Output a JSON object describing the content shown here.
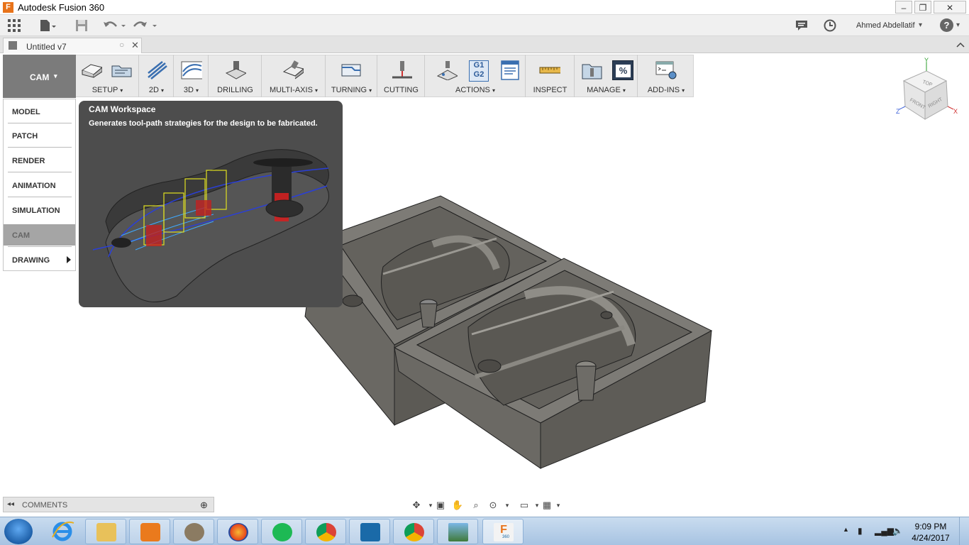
{
  "window": {
    "title": "Autodesk Fusion 360",
    "logo_letter": "F",
    "minimize": "‒",
    "restore": "❐",
    "close": "✕"
  },
  "appbar": {
    "user_name": "Ahmed Abdellatif",
    "help_label": "?",
    "icons": [
      "grid-icon",
      "file-icon",
      "save-icon",
      "undo-icon",
      "redo-icon",
      "comment-icon",
      "clock-icon",
      "help-icon"
    ]
  },
  "tab": {
    "name": "Untitled v7",
    "close": "✕"
  },
  "toolbar": {
    "workspace": "CAM",
    "groups": [
      {
        "label": "SETUP"
      },
      {
        "label": "2D"
      },
      {
        "label": "3D"
      },
      {
        "label": "DRILLING"
      },
      {
        "label": "MULTI-AXIS"
      },
      {
        "label": "TURNING"
      },
      {
        "label": "CUTTING"
      },
      {
        "label": "ACTIONS"
      },
      {
        "label": "INSPECT"
      },
      {
        "label": "MANAGE"
      },
      {
        "label": "ADD-INS"
      }
    ],
    "dropdown_arrow": "▾",
    "actions_codes": [
      "G1",
      "G2"
    ],
    "manage_symbol": "%"
  },
  "workspace_menu": {
    "items": [
      {
        "label": "MODEL"
      },
      {
        "label": "PATCH"
      },
      {
        "label": "RENDER"
      },
      {
        "label": "ANIMATION"
      },
      {
        "label": "SIMULATION"
      },
      {
        "label": "CAM",
        "active": true
      },
      {
        "label": "DRAWING",
        "submenu": true
      }
    ]
  },
  "tooltip": {
    "title": "CAM Workspace",
    "description": "Generates tool-path strategies for the design to be fabricated."
  },
  "viewcube": {
    "faces": {
      "top": "TOP",
      "front": "FRONT",
      "right": "RIGHT"
    },
    "axes": {
      "x": "X",
      "y": "Y",
      "z": "Z"
    }
  },
  "bottom": {
    "comments_label": "COMMENTS",
    "collapse": "◂◂",
    "add": "⊕"
  },
  "taskbar": {
    "time": "9:09 PM",
    "date": "4/24/2017",
    "app_icons": [
      "internet-explorer",
      "file-explorer",
      "media-player",
      "gimp",
      "firefox",
      "spotify",
      "chrome",
      "brackets",
      "chrome",
      "photo-viewer",
      "fusion-360"
    ],
    "fusion_label": "360"
  },
  "colors": {
    "accent": "#e8731a",
    "toolbar": "#e9e9e9",
    "workspace_button": "#7b7b7b",
    "tooltip_bg": "#4d4d4d",
    "model_fill": "#6d6b66"
  }
}
